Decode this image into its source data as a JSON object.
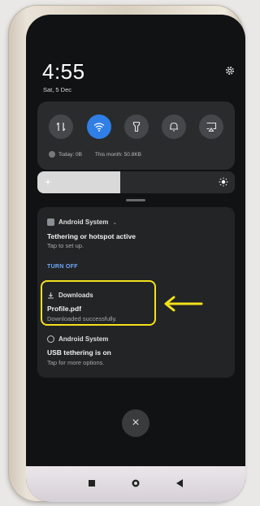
{
  "status": {
    "time": "4:55",
    "date": "Sat, 5 Dec"
  },
  "quick_settings": {
    "tiles": [
      {
        "icon": "data-transfer-icon",
        "active": false
      },
      {
        "icon": "wifi-icon",
        "active": true
      },
      {
        "icon": "flashlight-icon",
        "active": false
      },
      {
        "icon": "bell-icon",
        "active": false
      },
      {
        "icon": "screen-cast-icon",
        "active": false
      }
    ],
    "usage_today": "Today: 0B",
    "usage_month": "This month: 50.8KB"
  },
  "brightness": {
    "level": 0.42
  },
  "notifications": [
    {
      "app": "Android System",
      "title": "Tethering or hotspot active",
      "subtitle": "Tap to set up.",
      "action": "TURN OFF"
    },
    {
      "app": "Downloads",
      "title": "Profile.pdf",
      "subtitle": "Downloaded successfully."
    },
    {
      "app": "Android System",
      "title": "USB tethering is on",
      "subtitle": "Tap for more options."
    }
  ],
  "colors": {
    "accent": "#2f7fe6",
    "highlight": "#f3e21a"
  }
}
